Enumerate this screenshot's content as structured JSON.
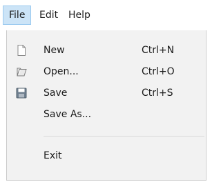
{
  "menubar": {
    "items": [
      {
        "label": "File"
      },
      {
        "label": "Edit"
      },
      {
        "label": "Help"
      }
    ]
  },
  "file_menu": {
    "items": [
      {
        "label": "New",
        "shortcut": "Ctrl+N",
        "icon": "new-document-icon"
      },
      {
        "label": "Open...",
        "shortcut": "Ctrl+O",
        "icon": "open-folder-icon"
      },
      {
        "label": "Save",
        "shortcut": "Ctrl+S",
        "icon": "floppy-disk-icon"
      },
      {
        "label": "Save As..."
      },
      {
        "label": "Exit"
      }
    ]
  },
  "colors": {
    "active_menu_bg": "#cce4f7",
    "active_menu_border": "#99c9ef",
    "dropdown_bg": "#f2f2f2"
  }
}
